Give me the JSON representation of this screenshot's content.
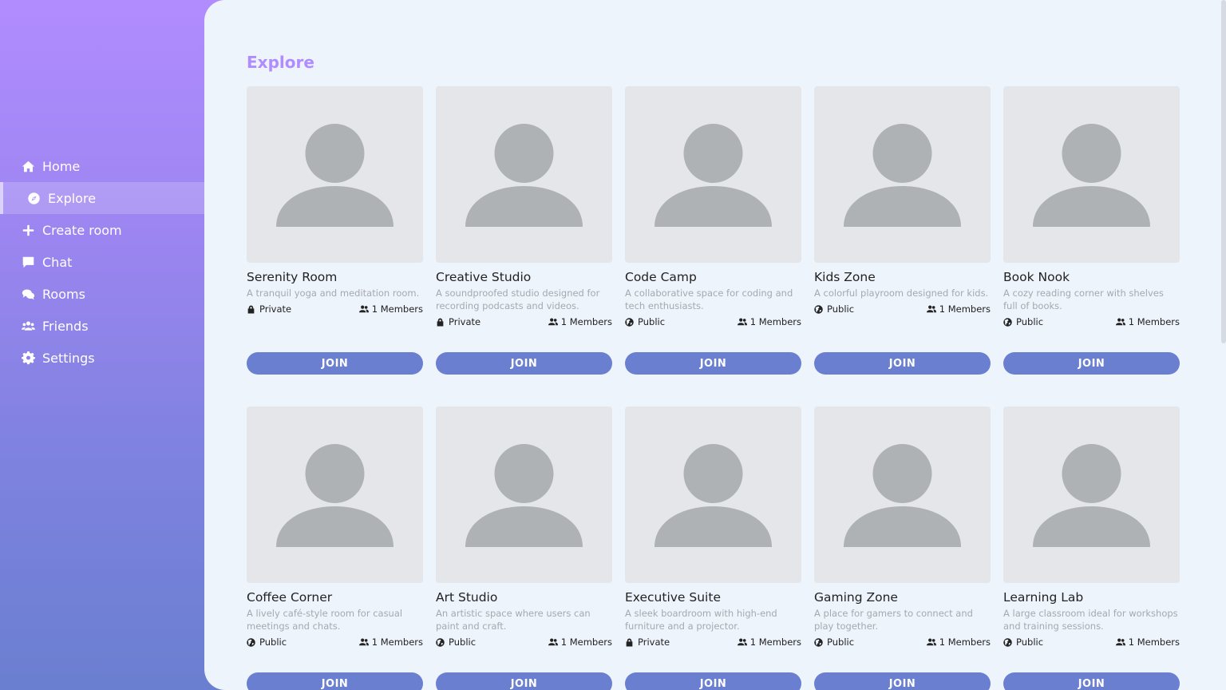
{
  "sidebar": {
    "items": [
      {
        "label": "Home",
        "icon": "home-icon"
      },
      {
        "label": "Explore",
        "icon": "compass-icon",
        "active": true
      },
      {
        "label": "Create room",
        "icon": "plus-icon"
      },
      {
        "label": "Chat",
        "icon": "chat-icon"
      },
      {
        "label": "Rooms",
        "icon": "comments-icon"
      },
      {
        "label": "Friends",
        "icon": "users-icon"
      },
      {
        "label": "Settings",
        "icon": "gear-icon"
      }
    ]
  },
  "main": {
    "title": "Explore",
    "join_label": "JOIN",
    "rooms": [
      {
        "name": "Serenity Room",
        "description": "A tranquil yoga and meditation room.",
        "privacy": "Private",
        "members": "1 Members"
      },
      {
        "name": "Creative Studio",
        "description": "A soundproofed studio designed for recording podcasts and videos.",
        "privacy": "Private",
        "members": "1 Members"
      },
      {
        "name": "Code Camp",
        "description": "A collaborative space for coding and tech enthusiasts.",
        "privacy": "Public",
        "members": "1 Members"
      },
      {
        "name": "Kids Zone",
        "description": "A colorful playroom designed for kids.",
        "privacy": "Public",
        "members": "1 Members"
      },
      {
        "name": "Book Nook",
        "description": "A cozy reading corner with shelves full of books.",
        "privacy": "Public",
        "members": "1 Members"
      },
      {
        "name": "Coffee Corner",
        "description": "A lively café-style room for casual meetings and chats.",
        "privacy": "Public",
        "members": "1 Members"
      },
      {
        "name": "Art Studio",
        "description": "An artistic space where users can paint and craft.",
        "privacy": "Public",
        "members": "1 Members"
      },
      {
        "name": "Executive Suite",
        "description": "A sleek boardroom with high-end furniture and a projector.",
        "privacy": "Private",
        "members": "1 Members"
      },
      {
        "name": "Gaming Zone",
        "description": "A place for gamers to connect and play together.",
        "privacy": "Public",
        "members": "1 Members"
      },
      {
        "name": "Learning Lab",
        "description": "A large classroom ideal for workshops and training sessions.",
        "privacy": "Public",
        "members": "1 Members"
      }
    ]
  },
  "colors": {
    "accent": "#b18cff",
    "button": "#6a7fd0",
    "content_bg": "#eef4fc"
  }
}
